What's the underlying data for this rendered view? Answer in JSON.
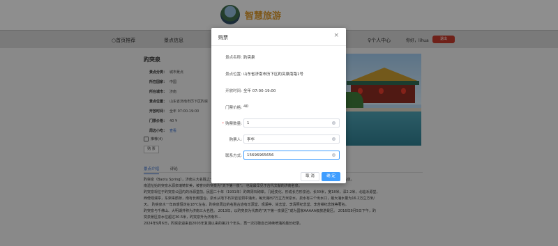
{
  "header": {
    "brand": "智慧旅游",
    "nav": {
      "home": "○首页推荐",
      "spots": "景点信息",
      "center": "♀个人中心"
    },
    "greeting": "你好，lihua",
    "logout_label": "退出"
  },
  "spot": {
    "title": "趵突泉",
    "info": [
      {
        "key": "景点分类：",
        "value": "城市景点"
      },
      {
        "key": "所在国家：",
        "value": "中国"
      },
      {
        "key": "所在城市：",
        "value": "济南"
      },
      {
        "key": "景点位置：",
        "value": "山东省济南市历下区趵突"
      },
      {
        "key": "开放时间：",
        "value": "全年 07:00-19:00"
      },
      {
        "key": "门票价格：",
        "value": "40 ¥"
      },
      {
        "key": "周边小吃：",
        "value": "查看"
      }
    ],
    "like_label": "推荐(4)",
    "buy_label": "购 票"
  },
  "tabs": [
    "景点介绍",
    "评论"
  ],
  "article": {
    "lines": [
      "趵突泉（Baotu Spring），济南三大名胜之一，… 位居济南七十二名泉之首，被誉为“天下第一泉”，也是最早见于古代文献的济南名泉。",
      "南遗址始的突泉水源泉瑞铸甘美，被誉封的突泉为“天下第一泉”。 也是最早见于古代文献的济南名泉。",
      "趵突泉现位于趵突泉公园内的泺源堂前。民国二十年（1931年）趵筑周石砌岸。几经变化，形成长方形泉池，长30米，宽18米，深2.2米，北临泺源堂，",
      "西傍观澜亭，东架来鹤桥，南有长廊围合。泉水从地下石灰岩溶洞中涌出，每天涌出7万立方米泉水，泉水有三个出水口，最大涌水量为16.2万立方米/",
      "天。 趵突泉水一年四季恒定在18℃左右。趵突泉周边的名胜古迹有泺源堂、观澜亭、尚志堂、李清照纪念堂、李苦禅纪念馆等著名。",
      "趵突泉与千佛山、大明湖并称为济南三大名胜。 2013年，以趵突泉为代表的“天下第一泉景区”成为国家AAAAA级旅游景区。 2016年9月5日下午，趵",
      "突泉景区泉水位超过30.5米，趵突泉升为济南市…",
      "2024年9月6日，趵突泉迎来自2003年复涌以来的第21个年头，再一次打破自己持续喷涌的最长纪录。"
    ]
  },
  "dialog": {
    "title": "购票",
    "close_label": "×",
    "fields": {
      "name": {
        "label": "景点名称:",
        "value": "趵突泉"
      },
      "location": {
        "label": "景点位置:",
        "value": "山东省济南市历下区趵突泉南路1号"
      },
      "hours": {
        "label": "开放时间:",
        "value": "全年 07:00-19:00"
      },
      "price": {
        "label": "门票价格:",
        "value": "40"
      },
      "quantity": {
        "label": "购票数量:",
        "value": "1"
      },
      "buyer": {
        "label": "购票人:",
        "value": "李华"
      },
      "phone": {
        "label": "联系方式:",
        "value": "15696965656"
      }
    },
    "clear_icon": "×",
    "cancel_label": "取 消",
    "confirm_label": "确 定"
  }
}
